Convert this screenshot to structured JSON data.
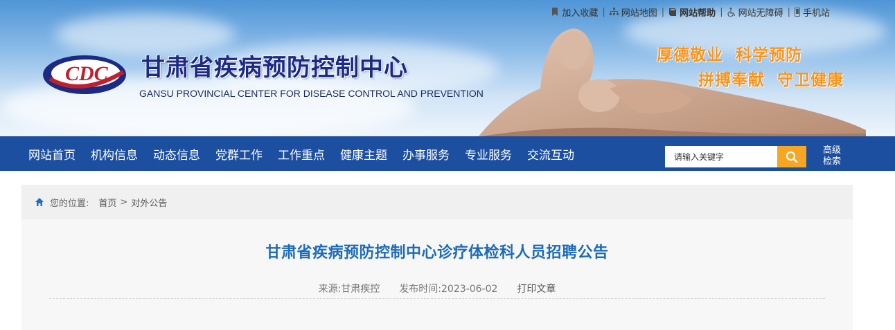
{
  "top_links": [
    {
      "icon": "bookmark-icon",
      "label": "加入收藏"
    },
    {
      "icon": "sitemap-icon",
      "label": "网站地图"
    },
    {
      "icon": "book-icon",
      "label": "网站帮助"
    },
    {
      "icon": "accessibility-icon",
      "label": "网站无障碍"
    },
    {
      "icon": "mobile-icon",
      "label": "手机站"
    }
  ],
  "header": {
    "logo_text": "CDC",
    "title_cn": "甘肃省疾病预防控制中心",
    "title_en": "GANSU PROVINCIAL CENTER FOR DISEASE CONTROL AND PREVENTION",
    "slogan_line1": "厚德敬业  科学预防",
    "slogan_line2": "拼搏奉献  守卫健康"
  },
  "nav": {
    "items": [
      "网站首页",
      "机构信息",
      "动态信息",
      "党群工作",
      "工作重点",
      "健康主题",
      "办事服务",
      "专业服务",
      "交流互动"
    ],
    "search_placeholder": "请输入关键字",
    "advanced_search": "高级\n检索"
  },
  "breadcrumb": {
    "label": "您的位置:",
    "items": [
      "首页",
      "对外公告"
    ],
    "separator": ">"
  },
  "article": {
    "title": "甘肃省疾病预防控制中心诊疗体检科人员招聘公告",
    "source": "来源:甘肃疾控",
    "publish_time": "发布时间:2023-06-02",
    "print_label": "打印文章"
  },
  "colors": {
    "nav_bg": "#1d4fa0",
    "title_blue": "#1c6bb8",
    "search_button": "#f5a623",
    "slogan_orange": "#f7941d",
    "site_title": "#1b2a84"
  }
}
